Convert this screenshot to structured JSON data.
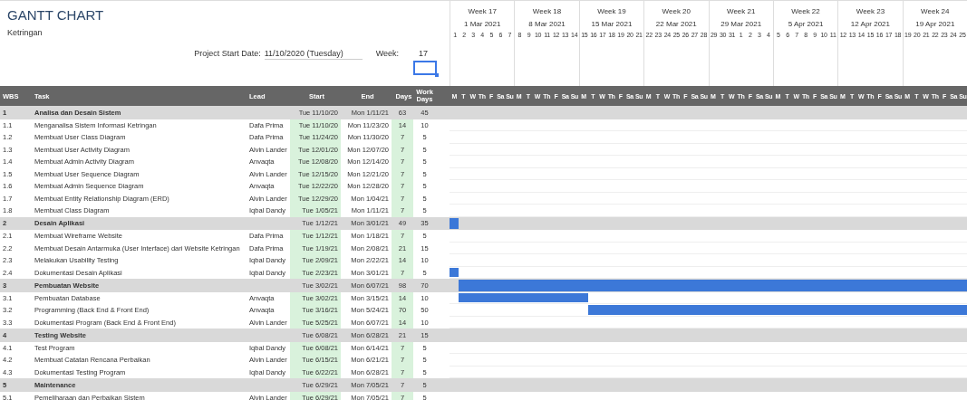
{
  "title": "GANTT CHART",
  "subtitle": "Ketringan",
  "project_start": {
    "label": "Project Start Date:",
    "value": "11/10/2020 (Tuesday)"
  },
  "week": {
    "label": "Week:",
    "value": "17"
  },
  "weeks": [
    {
      "label": "Week 17",
      "date": "1 Mar 2021",
      "days": [
        "1",
        "2",
        "3",
        "4",
        "5",
        "6",
        "7"
      ],
      "weekdays": [
        "M",
        "T",
        "W",
        "Th",
        "F",
        "Sa",
        "Su"
      ]
    },
    {
      "label": "Week 18",
      "date": "8 Mar 2021",
      "days": [
        "8",
        "9",
        "10",
        "11",
        "12",
        "13",
        "14"
      ],
      "weekdays": [
        "M",
        "T",
        "W",
        "Th",
        "F",
        "Sa",
        "Su"
      ]
    },
    {
      "label": "Week 19",
      "date": "15 Mar 2021",
      "days": [
        "15",
        "16",
        "17",
        "18",
        "19",
        "20",
        "21"
      ],
      "weekdays": [
        "M",
        "T",
        "W",
        "Th",
        "F",
        "Sa",
        "Su"
      ]
    },
    {
      "label": "Week 20",
      "date": "22 Mar 2021",
      "days": [
        "22",
        "23",
        "24",
        "25",
        "26",
        "27",
        "28"
      ],
      "weekdays": [
        "M",
        "T",
        "W",
        "Th",
        "F",
        "Sa",
        "Su"
      ]
    },
    {
      "label": "Week 21",
      "date": "29 Mar 2021",
      "days": [
        "29",
        "30",
        "31",
        "1",
        "2",
        "3",
        "4"
      ],
      "weekdays": [
        "M",
        "T",
        "W",
        "Th",
        "F",
        "Sa",
        "Su"
      ]
    },
    {
      "label": "Week 22",
      "date": "5 Apr 2021",
      "days": [
        "5",
        "6",
        "7",
        "8",
        "9",
        "10",
        "11"
      ],
      "weekdays": [
        "M",
        "T",
        "W",
        "Th",
        "F",
        "Sa",
        "Su"
      ]
    },
    {
      "label": "Week 23",
      "date": "12 Apr 2021",
      "days": [
        "12",
        "13",
        "14",
        "15",
        "16",
        "17",
        "18"
      ],
      "weekdays": [
        "M",
        "T",
        "W",
        "Th",
        "F",
        "Sa",
        "Su"
      ]
    },
    {
      "label": "Week 24",
      "date": "19 Apr 2021",
      "days": [
        "19",
        "20",
        "21",
        "22",
        "23",
        "24",
        "25"
      ],
      "weekdays": [
        "M",
        "T",
        "W",
        "Th",
        "F",
        "Sa",
        "Su"
      ]
    }
  ],
  "columns": [
    "WBS",
    "Task",
    "Lead",
    "Start",
    "End",
    "Days",
    "Work Days"
  ],
  "rows": [
    {
      "kind": "group",
      "wbs": "1",
      "task": "Analisa dan Desain Sistem",
      "start": "Tue 11/10/20",
      "end": "Mon 1/11/21",
      "days": "63",
      "work_days": "45"
    },
    {
      "kind": "task",
      "wbs": "1.1",
      "task": "Menganalisa Sistem Informasi Ketringan",
      "lead": "Dafa Prima",
      "start": "Tue 11/10/20",
      "end": "Mon 11/23/20",
      "days": "14",
      "work_days": "10"
    },
    {
      "kind": "task",
      "wbs": "1.2",
      "task": "Membuat User Class Diagram",
      "lead": "Dafa Prima",
      "start": "Tue 11/24/20",
      "end": "Mon 11/30/20",
      "days": "7",
      "work_days": "5"
    },
    {
      "kind": "task",
      "wbs": "1.3",
      "task": "Membuat User Activity Diagram",
      "lead": "Alvin Lander",
      "start": "Tue 12/01/20",
      "end": "Mon 12/07/20",
      "days": "7",
      "work_days": "5"
    },
    {
      "kind": "task",
      "wbs": "1.4",
      "task": "Membuat Admin Activity Diagram",
      "lead": "Anvaqta",
      "start": "Tue 12/08/20",
      "end": "Mon 12/14/20",
      "days": "7",
      "work_days": "5"
    },
    {
      "kind": "task",
      "wbs": "1.5",
      "task": "Membuat User Sequence Diagram",
      "lead": "Alvin Lander",
      "start": "Tue 12/15/20",
      "end": "Mon 12/21/20",
      "days": "7",
      "work_days": "5"
    },
    {
      "kind": "task",
      "wbs": "1.6",
      "task": "Membuat Admin Sequence Diagram",
      "lead": "Anvaqta",
      "start": "Tue 12/22/20",
      "end": "Mon 12/28/20",
      "days": "7",
      "work_days": "5"
    },
    {
      "kind": "task",
      "wbs": "1.7",
      "task": "Membuat Entity Relationship Diagram (ERD)",
      "lead": "Alvin Lander",
      "start": "Tue 12/29/20",
      "end": "Mon 1/04/21",
      "days": "7",
      "work_days": "5"
    },
    {
      "kind": "task",
      "wbs": "1.8",
      "task": "Membuat Class Diagram",
      "lead": "Iqbal Dandy",
      "start": "Tue 1/05/21",
      "end": "Mon 1/11/21",
      "days": "7",
      "work_days": "5"
    },
    {
      "kind": "group",
      "wbs": "2",
      "task": "Desain Aplikasi",
      "start": "Tue 1/12/21",
      "end": "Mon 3/01/21",
      "days": "49",
      "work_days": "35"
    },
    {
      "kind": "task",
      "wbs": "2.1",
      "task": "Membuat Wireframe Website",
      "lead": "Dafa Prima",
      "start": "Tue 1/12/21",
      "end": "Mon 1/18/21",
      "days": "7",
      "work_days": "5"
    },
    {
      "kind": "task",
      "wbs": "2.2",
      "task": "Membuat Desain Antarmuka (User Interface) dari Website Ketringan",
      "lead": "Dafa Prima",
      "start": "Tue 1/19/21",
      "end": "Mon 2/08/21",
      "days": "21",
      "work_days": "15"
    },
    {
      "kind": "task",
      "wbs": "2.3",
      "task": "Melakukan Usability Testing",
      "lead": "Iqbal Dandy",
      "start": "Tue 2/09/21",
      "end": "Mon 2/22/21",
      "days": "14",
      "work_days": "10"
    },
    {
      "kind": "task",
      "wbs": "2.4",
      "task": "Dokumentasi Desain Aplikasi",
      "lead": "Iqbal Dandy",
      "start": "Tue 2/23/21",
      "end": "Mon 3/01/21",
      "days": "7",
      "work_days": "5"
    },
    {
      "kind": "group",
      "wbs": "3",
      "task": "Pembuatan Website",
      "start": "Tue 3/02/21",
      "end": "Mon 6/07/21",
      "days": "98",
      "work_days": "70"
    },
    {
      "kind": "task",
      "wbs": "3.1",
      "task": "Pembuatan Database",
      "lead": "Anvaqta",
      "start": "Tue 3/02/21",
      "end": "Mon 3/15/21",
      "days": "14",
      "work_days": "10"
    },
    {
      "kind": "task",
      "wbs": "3.2",
      "task": "Programming (Back End & Front End)",
      "lead": "Anvaqta",
      "start": "Tue 3/16/21",
      "end": "Mon 5/24/21",
      "days": "70",
      "work_days": "50"
    },
    {
      "kind": "task",
      "wbs": "3.3",
      "task": "Dokumentasi Program (Back End & Front End)",
      "lead": "Alvin Lander",
      "start": "Tue 5/25/21",
      "end": "Mon 6/07/21",
      "days": "14",
      "work_days": "10"
    },
    {
      "kind": "group",
      "wbs": "4",
      "task": "Testing Website",
      "start": "Tue 6/08/21",
      "end": "Mon 6/28/21",
      "days": "21",
      "work_days": "15"
    },
    {
      "kind": "task",
      "wbs": "4.1",
      "task": "Test Program",
      "lead": "Iqbal Dandy",
      "start": "Tue 6/08/21",
      "end": "Mon 6/14/21",
      "days": "7",
      "work_days": "5"
    },
    {
      "kind": "task",
      "wbs": "4.2",
      "task": "Membuat Catatan Rencana Perbaikan",
      "lead": "Alvin Lander",
      "start": "Tue 6/15/21",
      "end": "Mon 6/21/21",
      "days": "7",
      "work_days": "5"
    },
    {
      "kind": "task",
      "wbs": "4.3",
      "task": "Dokumentasi Testing Program",
      "lead": "Iqbal Dandy",
      "start": "Tue 6/22/21",
      "end": "Mon 6/28/21",
      "days": "7",
      "work_days": "5"
    },
    {
      "kind": "group",
      "wbs": "5",
      "task": "Maintenance",
      "start": "Tue 6/29/21",
      "end": "Mon 7/05/21",
      "days": "7",
      "work_days": "5"
    },
    {
      "kind": "task",
      "wbs": "5.1",
      "task": "Pemeliharaan dan Perbaikan Sistem",
      "lead": "Alvin Lander",
      "start": "Tue 6/29/21",
      "end": "Mon 7/05/21",
      "days": "7",
      "work_days": "5"
    }
  ]
}
